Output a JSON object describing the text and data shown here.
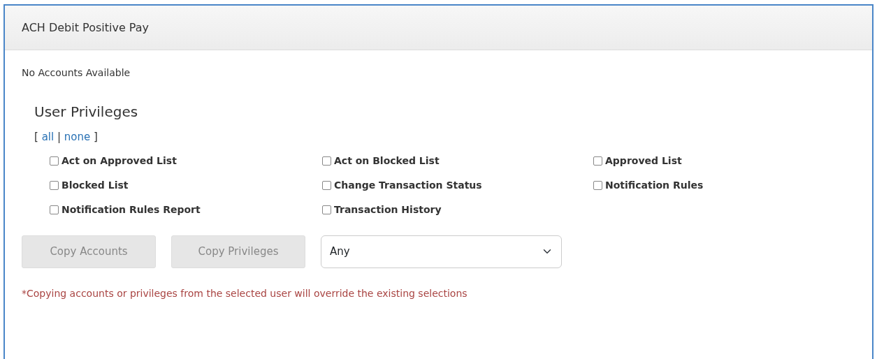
{
  "panel": {
    "title": "ACH Debit Positive Pay"
  },
  "accounts_message": "No Accounts Available",
  "privileges": {
    "heading": "User Privileges",
    "open_bracket": "[",
    "all_link": "all",
    "separator": "|",
    "none_link": "none",
    "close_bracket": "]",
    "items": [
      {
        "label": "Act on Approved List",
        "checked": false
      },
      {
        "label": "Act on Blocked List",
        "checked": false
      },
      {
        "label": "Approved List",
        "checked": false
      },
      {
        "label": "Blocked List",
        "checked": false
      },
      {
        "label": "Change Transaction Status",
        "checked": false
      },
      {
        "label": "Notification Rules",
        "checked": false
      },
      {
        "label": "Notification Rules Report",
        "checked": false
      },
      {
        "label": "Transaction History",
        "checked": false
      }
    ]
  },
  "buttons": [
    {
      "label": "Copy Accounts",
      "disabled": true
    },
    {
      "label": "Copy Privileges",
      "disabled": true
    }
  ],
  "user_select": {
    "value": "Any"
  },
  "note": "*Copying accounts or privileges from the selected user will override the existing selections"
}
